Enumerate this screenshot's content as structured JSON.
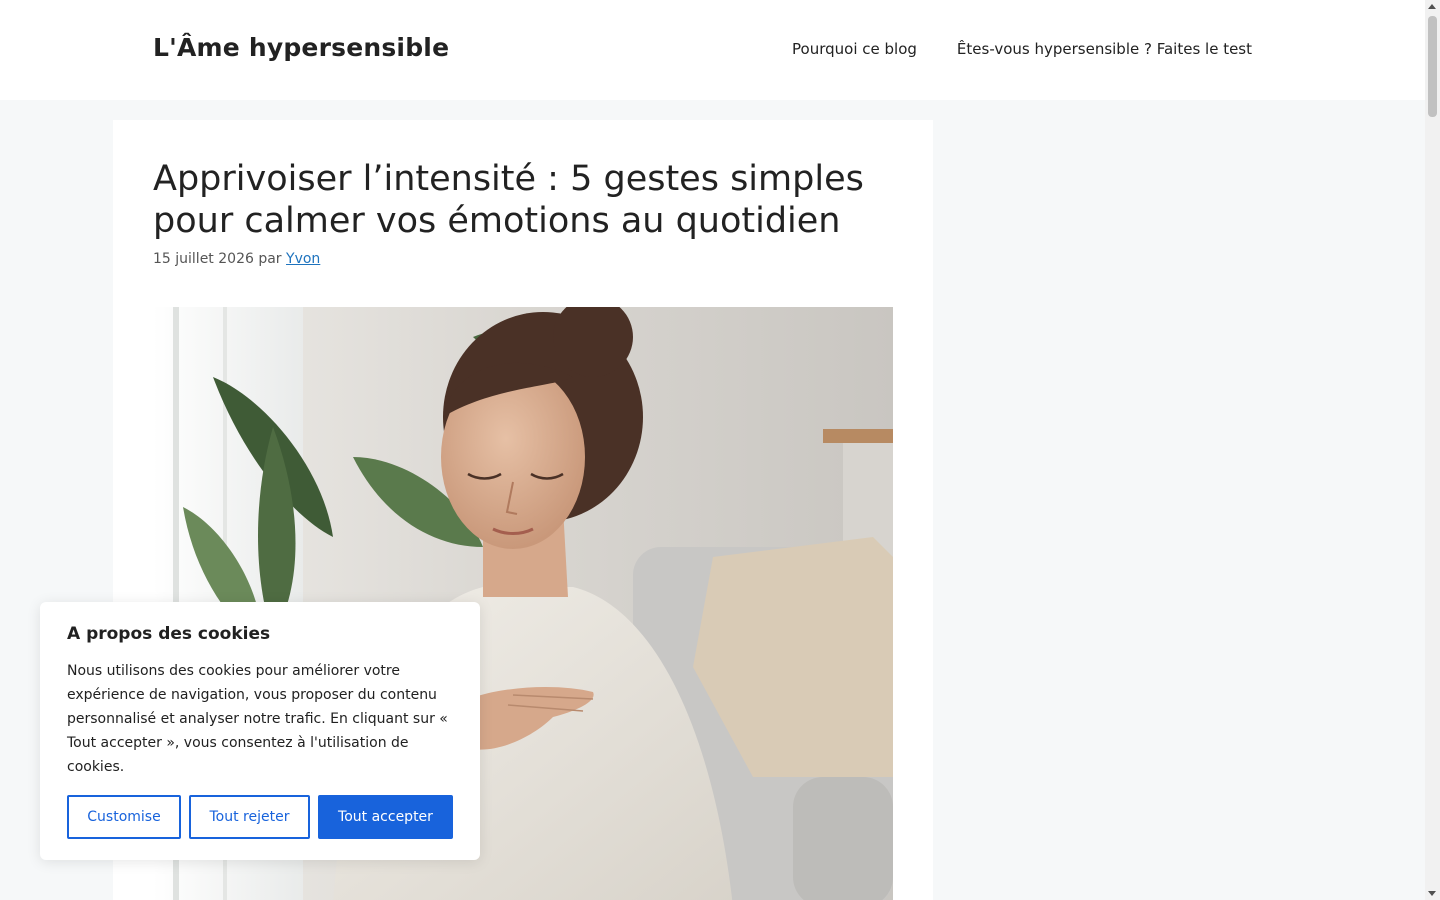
{
  "header": {
    "site_title": "L'Âme hypersensible",
    "nav": [
      {
        "label": "Pourquoi ce blog"
      },
      {
        "label": "Êtes-vous hypersensible ? Faites le test"
      }
    ]
  },
  "article": {
    "title": "Apprivoiser l’intensité : 5 gestes simples pour calmer vos émotions au quotidien",
    "date": "15 juillet 2026",
    "by": "par",
    "author": "Yvon"
  },
  "cookie_banner": {
    "title": "A propos des cookies",
    "text": "Nous utilisons des cookies pour améliorer votre expérience de navigation, vous proposer du contenu personnalisé et analyser notre trafic. En cliquant sur « Tout accepter », vous consentez à l'utilisation de cookies.",
    "buttons": {
      "customise": "Customise",
      "reject": "Tout rejeter",
      "accept": "Tout accepter"
    }
  },
  "colors": {
    "accent": "#1863dc",
    "link": "#1e73be",
    "background": "#f6f8f9"
  }
}
